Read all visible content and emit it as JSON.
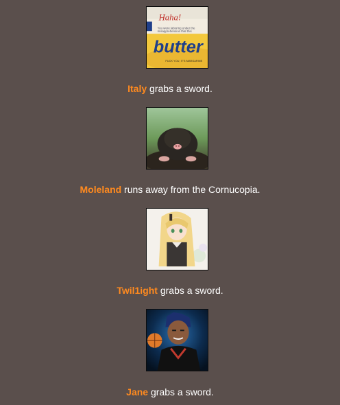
{
  "events": [
    {
      "tribute": "Italy",
      "action": " grabs a sword.",
      "image": "butter-tub-image",
      "image_text": [
        "Haha!",
        "You were laboring under the",
        "misapprehension that this",
        "butter",
        "FUCK YOU, IT'S MARGARINE"
      ]
    },
    {
      "tribute": "Moleland",
      "action": " runs away from the Cornucopia.",
      "image": "mole-image"
    },
    {
      "tribute": "Twil1ight",
      "action": " grabs a sword.",
      "image": "anime-blonde-girl-image"
    },
    {
      "tribute": "Jane",
      "action": " grabs a sword.",
      "image": "anime-basketball-player-image"
    }
  ],
  "colors": {
    "background": "#5a4f4c",
    "tribute_name": "#ff8a1f",
    "text": "#ffffff"
  }
}
